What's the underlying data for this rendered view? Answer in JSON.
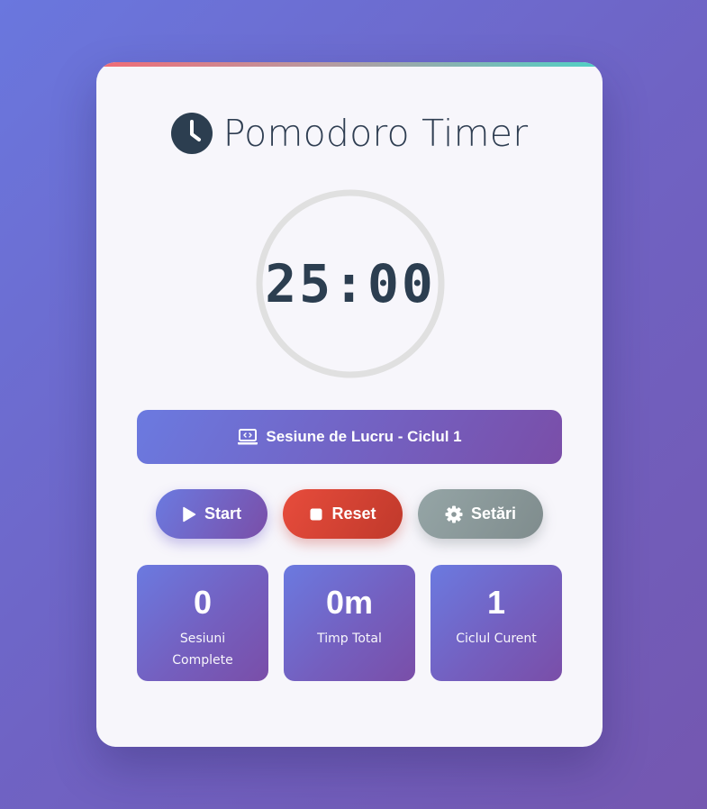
{
  "app": {
    "title": "Pomodoro Timer",
    "title_icon": "clock-icon"
  },
  "timer": {
    "display": "25:00",
    "progress_fraction": 0
  },
  "session": {
    "icon": "laptop-code-icon",
    "label": "Sesiune de Lucru - Ciclul 1"
  },
  "controls": {
    "start_label": "Start",
    "start_icon": "play-icon",
    "reset_label": "Reset",
    "reset_icon": "stop-icon",
    "settings_label": "Setări",
    "settings_icon": "gear-icon"
  },
  "stats": [
    {
      "value": "0",
      "label": "Sesiuni Complete"
    },
    {
      "value": "0m",
      "label": "Timp Total"
    },
    {
      "value": "1",
      "label": "Ciclul Curent"
    }
  ],
  "colors": {
    "background_start": "#6a77de",
    "background_end": "#7457b0",
    "card": "#f7f6fb",
    "text_dark": "#2c3e50",
    "accent_gradient_start": "#6b7ae0",
    "accent_gradient_end": "#7a4ea8",
    "reset": "#e74c3c",
    "settings": "#95a5a6",
    "top_bar_start": "#f26b75",
    "top_bar_end": "#4fd1c5",
    "ring_track": "#e0e0e0"
  }
}
